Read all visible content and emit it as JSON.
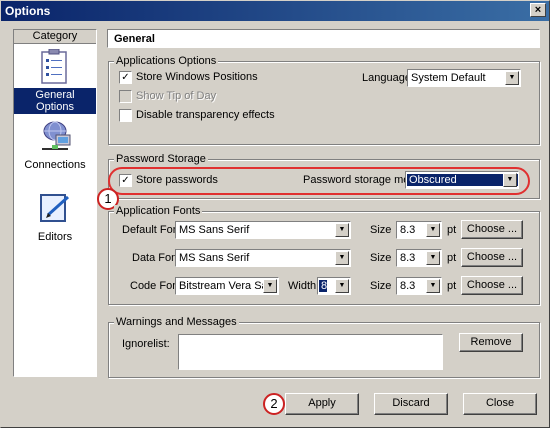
{
  "window": {
    "title": "Options",
    "close_glyph": "×"
  },
  "category": {
    "header": "Category",
    "items": [
      {
        "label": "General Options",
        "icon": "clipboard-checklist-icon",
        "selected": true
      },
      {
        "label": "Connections",
        "icon": "network-computer-icon",
        "selected": false
      },
      {
        "label": "Editors",
        "icon": "editor-pen-icon",
        "selected": false
      }
    ]
  },
  "section_title": "General",
  "app_options": {
    "legend": "Applications Options",
    "store_windows_positions": {
      "label": "Store Windows Positions",
      "checked": true
    },
    "show_tip_of_day": {
      "label": "Show Tip of Day",
      "checked": false,
      "disabled": true
    },
    "disable_transparency": {
      "label": "Disable transparency effects",
      "checked": false
    },
    "language_label": "Language:",
    "language_value": "System Default"
  },
  "password_storage": {
    "legend": "Password Storage",
    "store_passwords": {
      "label": "Store passwords",
      "checked": true
    },
    "method_label": "Password storage method:",
    "method_value": "Obscured"
  },
  "fonts": {
    "legend": "Application Fonts",
    "default_font_label": "Default Font:",
    "default_font_value": "MS Sans Serif",
    "data_font_label": "Data Font:",
    "data_font_value": "MS Sans Serif",
    "code_font_label": "Code Font:",
    "code_font_value": "Bitstream Vera Sans Mo",
    "width_label": "Width:",
    "width_value": "8",
    "size_label": "Size",
    "pt_label": "pt",
    "default_size": "8.3",
    "data_size": "8.3",
    "code_size": "8.3",
    "choose_label": "Choose ..."
  },
  "warnings": {
    "legend": "Warnings and Messages",
    "ignorelist_label": "Ignorelist:",
    "ignorelist_value": "",
    "remove_label": "Remove"
  },
  "buttons": {
    "apply": "Apply",
    "discard": "Discard",
    "close": "Close"
  },
  "callouts": {
    "one": "1",
    "two": "2"
  },
  "colors": {
    "selection": "#0a246a",
    "callout_red": "#e03030",
    "face": "#d4d0c8"
  }
}
